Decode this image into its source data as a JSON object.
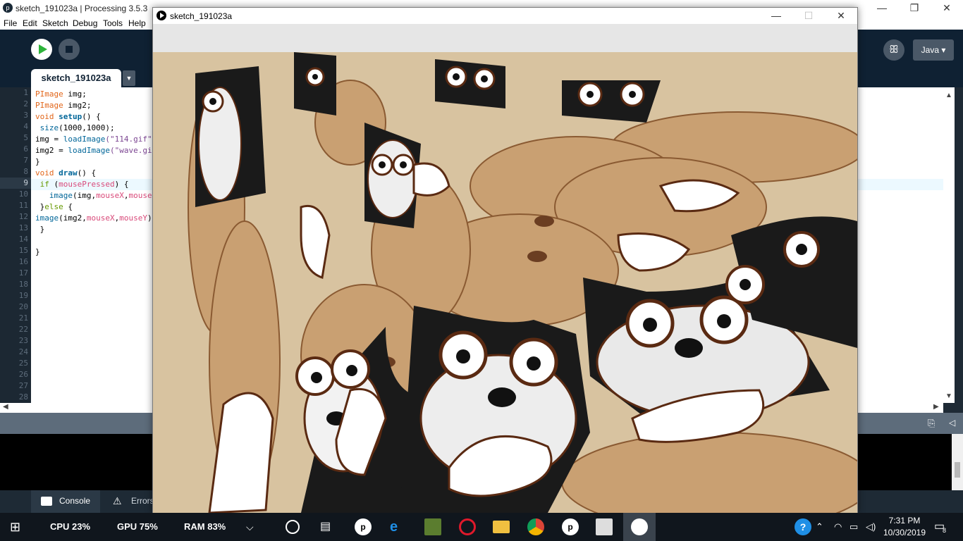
{
  "ide": {
    "title": "sketch_191023a | Processing 3.5.3",
    "app_icon": "processing-icon",
    "menu": [
      "File",
      "Edit",
      "Sketch",
      "Debug",
      "Tools",
      "Help"
    ],
    "mode": "Java ▾",
    "tab": "sketch_191023a",
    "tab_menu": "▼",
    "line_numbers": [
      "1",
      "2",
      "3",
      "4",
      "5",
      "6",
      "7",
      "8",
      "9",
      "10",
      "11",
      "12",
      "13",
      "14",
      "15",
      "16",
      "17",
      "18",
      "19",
      "20",
      "21",
      "22",
      "23",
      "24",
      "25",
      "26",
      "27",
      "28"
    ],
    "current_line": "9",
    "code": [
      {
        "t": "type",
        "a": "PImage",
        "b": " img;"
      },
      {
        "t": "type",
        "a": "PImage",
        "b": " img2;"
      },
      {
        "t": "fn",
        "a": "void ",
        "f": "setup",
        "b": "() {"
      },
      {
        "t": "call",
        "a": " ",
        "f": "size",
        "b": "(1000,1000);"
      },
      {
        "t": "str",
        "a": "img = ",
        "f": "loadImage",
        "s": "(\"114.gif\");"
      },
      {
        "t": "str",
        "a": "img2 = ",
        "f": "loadImage",
        "s": "(\"wave.gif\");"
      },
      {
        "t": "plain",
        "a": "}"
      },
      {
        "t": "fn",
        "a": "void ",
        "f": "draw",
        "b": "() {"
      },
      {
        "t": "if",
        "a": " ",
        "k": "if",
        "c": " (",
        "v": "mousePressed",
        "d": ") {"
      },
      {
        "t": "img",
        "a": "   ",
        "f": "image",
        "c": "(img,",
        "v": "mouseX",
        "d": ",",
        "w": "mouseY",
        "e": ");"
      },
      {
        "t": "else",
        "a": " }",
        "k": "else",
        "d": " {"
      },
      {
        "t": "img",
        "a": "",
        "f": "image",
        "c": "(img2,",
        "v": "mouseX",
        "d": ",",
        "w": "mouseY",
        "e": ");"
      },
      {
        "t": "plain",
        "a": " }"
      },
      {
        "t": "plain",
        "a": ""
      },
      {
        "t": "plain",
        "a": "}"
      }
    ],
    "console_tab": "Console",
    "errors_tab": "Errors"
  },
  "sketch_window": {
    "title": "sketch_191023a",
    "canvas_icon": "dog-collage-image"
  },
  "taskbar": {
    "cpu": "CPU  23%",
    "gpu": "GPU  75%",
    "ram": "RAM  83%",
    "time": "7:31 PM",
    "date": "10/30/2019",
    "notifications": "8"
  },
  "colors": {
    "ide_dark": "#0f2133",
    "play_green": "#2db33a",
    "panel_gray": "#5d6c7b"
  }
}
